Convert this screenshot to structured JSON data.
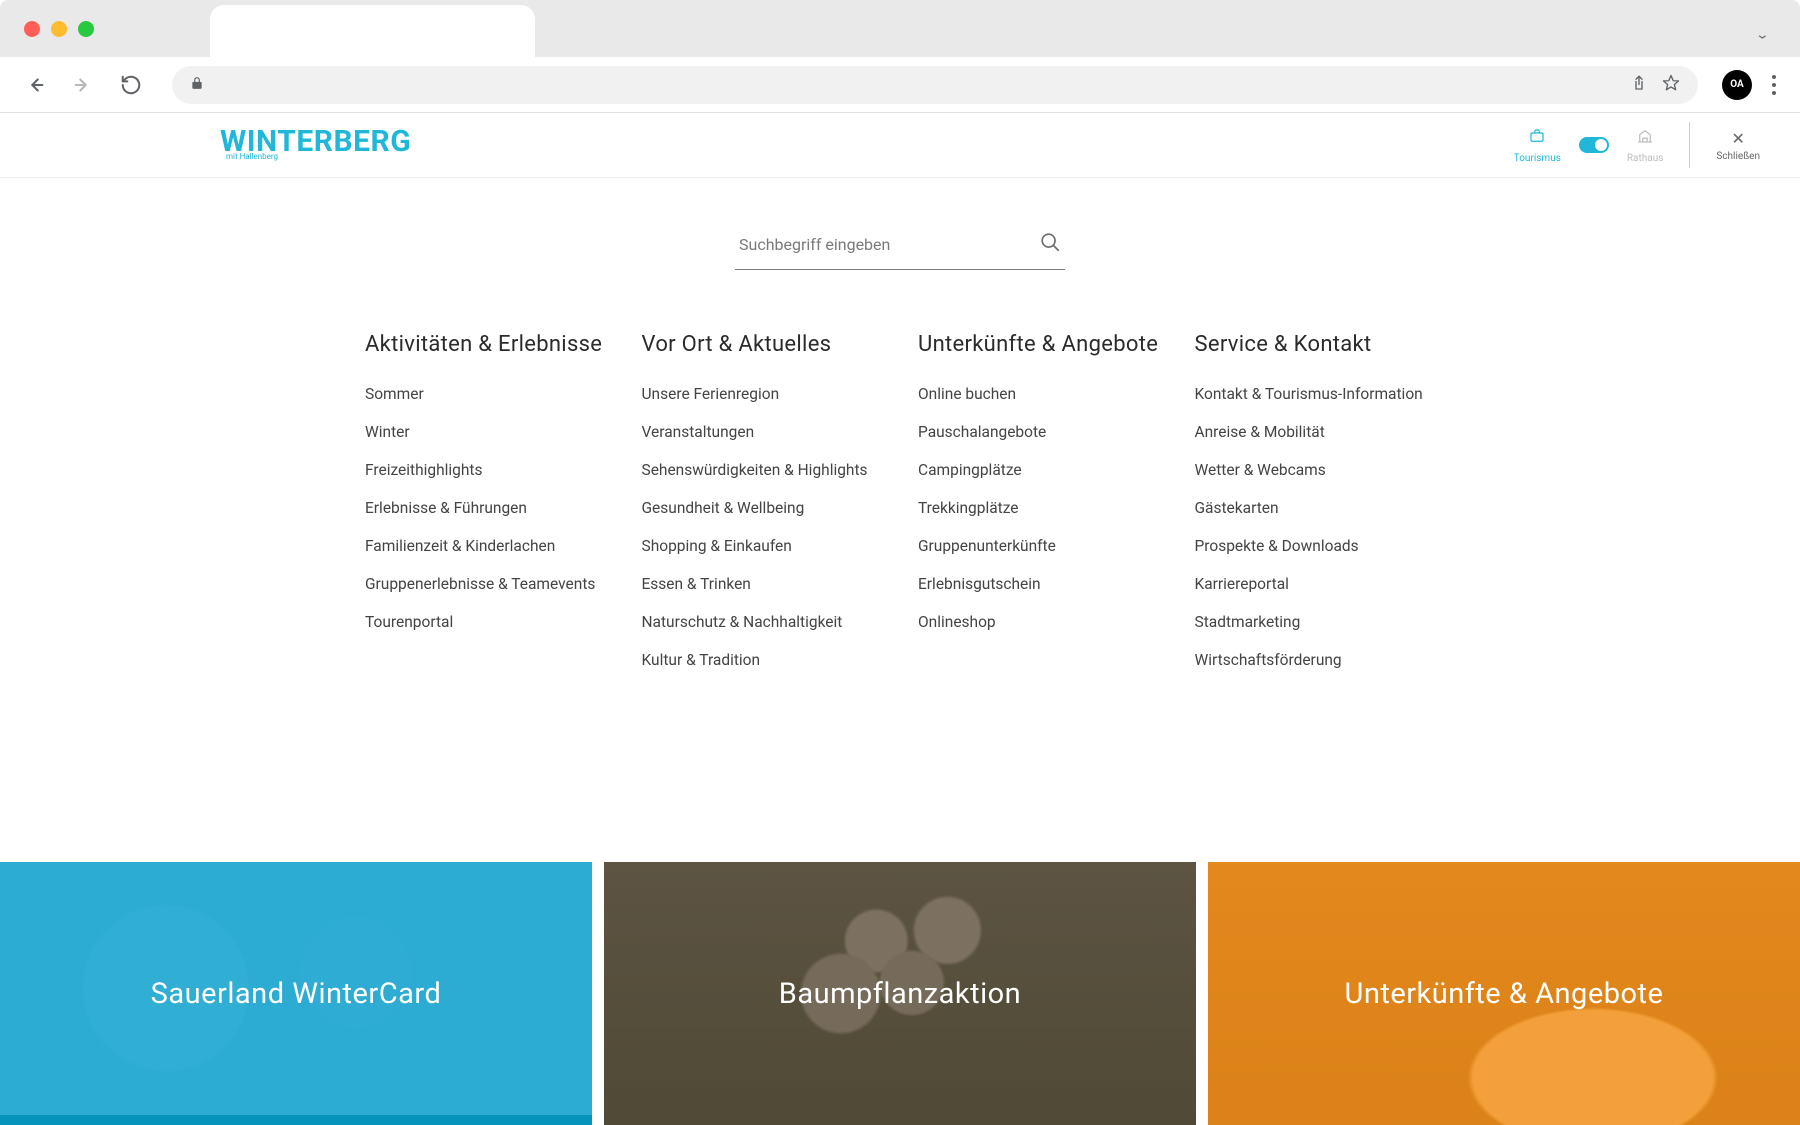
{
  "header": {
    "logo_main": "WINTERBERG",
    "logo_sub": "mit Hallenberg",
    "mode_active": "Tourismus",
    "mode_inactive": "Rathaus",
    "close_label": "Schließen"
  },
  "search": {
    "placeholder": "Suchbegriff eingeben"
  },
  "menu": {
    "columns": [
      {
        "title": "Aktivitäten & Erlebnisse",
        "items": [
          "Sommer",
          "Winter",
          "Freizeithighlights",
          "Erlebnisse & Führungen",
          "Familienzeit & Kinderlachen",
          "Gruppenerlebnisse & Teamevents",
          "Tourenportal"
        ]
      },
      {
        "title": "Vor Ort & Aktuelles",
        "items": [
          "Unsere Ferienregion",
          "Veranstaltungen",
          "Sehenswürdigkeiten & Highlights",
          "Gesundheit & Wellbeing",
          "Shopping & Einkaufen",
          "Essen & Trinken",
          "Naturschutz & Nachhaltigkeit",
          "Kultur & Tradition"
        ]
      },
      {
        "title": "Unterkünfte & Angebote",
        "items": [
          "Online buchen",
          "Pauschalangebote",
          "Campingplätze",
          "Trekkingplätze",
          "Gruppenunterkünfte",
          "Erlebnisgutschein",
          "Onlineshop"
        ]
      },
      {
        "title": "Service & Kontakt",
        "items": [
          "Kontakt & Tourismus-Information",
          "Anreise & Mobilität",
          "Wetter & Webcams",
          "Gästekarten",
          "Prospekte & Downloads",
          "Karriereportal",
          "Stadtmarketing",
          "Wirtschaftsförderung"
        ]
      }
    ]
  },
  "cards": [
    {
      "title": "Sauerland WinterCard"
    },
    {
      "title": "Baumpflanzaktion"
    },
    {
      "title": "Unterkünfte & Angebote"
    }
  ],
  "profile_badge": "OA"
}
